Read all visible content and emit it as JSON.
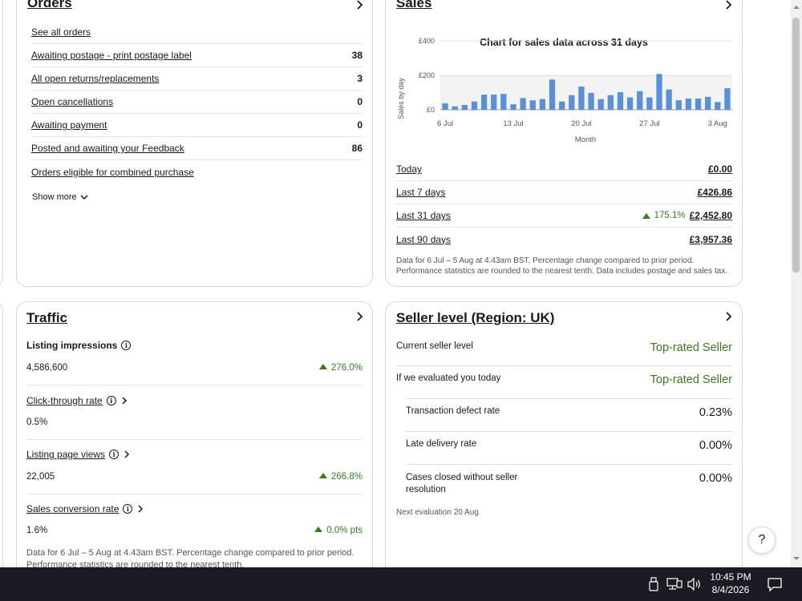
{
  "orders": {
    "title": "Orders",
    "see_all": "See all orders",
    "rows": [
      {
        "label": "Awaiting postage - print postage label",
        "value": "38"
      },
      {
        "label": "All open returns/replacements",
        "value": "3"
      },
      {
        "label": "Open cancellations",
        "value": "0"
      },
      {
        "label": "Awaiting payment",
        "value": "0"
      },
      {
        "label": "Posted and awaiting your Feedback",
        "value": "86"
      },
      {
        "label": "Orders eligible for combined purchase",
        "value": ""
      }
    ],
    "show_more": "Show more"
  },
  "sales": {
    "title": "Sales",
    "rows": [
      {
        "label": "Today",
        "value": "£0.00",
        "change": ""
      },
      {
        "label": "Last 7 days",
        "value": "£426.86",
        "change": ""
      },
      {
        "label": "Last 31 days",
        "value": "£2,452.80",
        "change": "175.1%"
      },
      {
        "label": "Last 90 days",
        "value": "£3,957.36",
        "change": ""
      }
    ],
    "note": "Data for 6 Jul – 5 Aug at 4.43am BST. Percentage change compared to prior period. Performance statistics are rounded to the nearest tenth. Data includes postage and sales tax."
  },
  "chart_data": {
    "type": "bar",
    "title": "Chart for sales data across 31 days",
    "xlabel": "Month",
    "ylabel": "Sales by day",
    "ylim": [
      0,
      400
    ],
    "yticks": [
      "£0",
      "£200",
      "£400"
    ],
    "xticks": [
      {
        "label": "6 Jul",
        "index": 0
      },
      {
        "label": "13 Jul",
        "index": 7
      },
      {
        "label": "20 Jul",
        "index": 14
      },
      {
        "label": "27 Jul",
        "index": 21
      },
      {
        "label": "3 Aug",
        "index": 28
      }
    ],
    "values": [
      38,
      20,
      28,
      48,
      88,
      88,
      92,
      32,
      68,
      55,
      62,
      175,
      48,
      85,
      135,
      98,
      62,
      85,
      102,
      72,
      108,
      72,
      208,
      118,
      55,
      65,
      65,
      75,
      45,
      125
    ],
    "bar_color": "#5b8fd6",
    "grid": true
  },
  "traffic": {
    "title": "Traffic",
    "sections": [
      {
        "label": "Listing impressions",
        "value": "4,586,600",
        "change": "276.0%",
        "link": false
      },
      {
        "label": "Click-through rate",
        "value": "0.5%",
        "change": "",
        "link": true
      },
      {
        "label": "Listing page views",
        "value": "22,005",
        "change": "266.8%",
        "link": true
      },
      {
        "label": "Sales conversion rate",
        "value": "1.6%",
        "change": "0.0% pts",
        "link": true
      }
    ],
    "note": "Data for 6 Jul – 5 Aug at 4.43am BST. Percentage change compared to prior period. Performance statistics are rounded to the nearest tenth."
  },
  "seller": {
    "title": "Seller level (Region: UK)",
    "rows": [
      {
        "label": "Current seller level",
        "value": "Top-rated Seller",
        "indent": false
      },
      {
        "label": "If we evaluated you today",
        "value": "Top-rated Seller",
        "indent": false
      },
      {
        "label": "Transaction defect rate",
        "value": "0.23%",
        "indent": true
      },
      {
        "label": "Late delivery rate",
        "value": "0.00%",
        "indent": true
      },
      {
        "label": "Cases closed without seller resolution",
        "value": "0.00%",
        "indent": true
      }
    ],
    "next_eval": "Next evaluation 20 Aug"
  },
  "help_label": "?",
  "taskbar": {
    "time": "10:45 PM",
    "date": "8/4/2026"
  }
}
